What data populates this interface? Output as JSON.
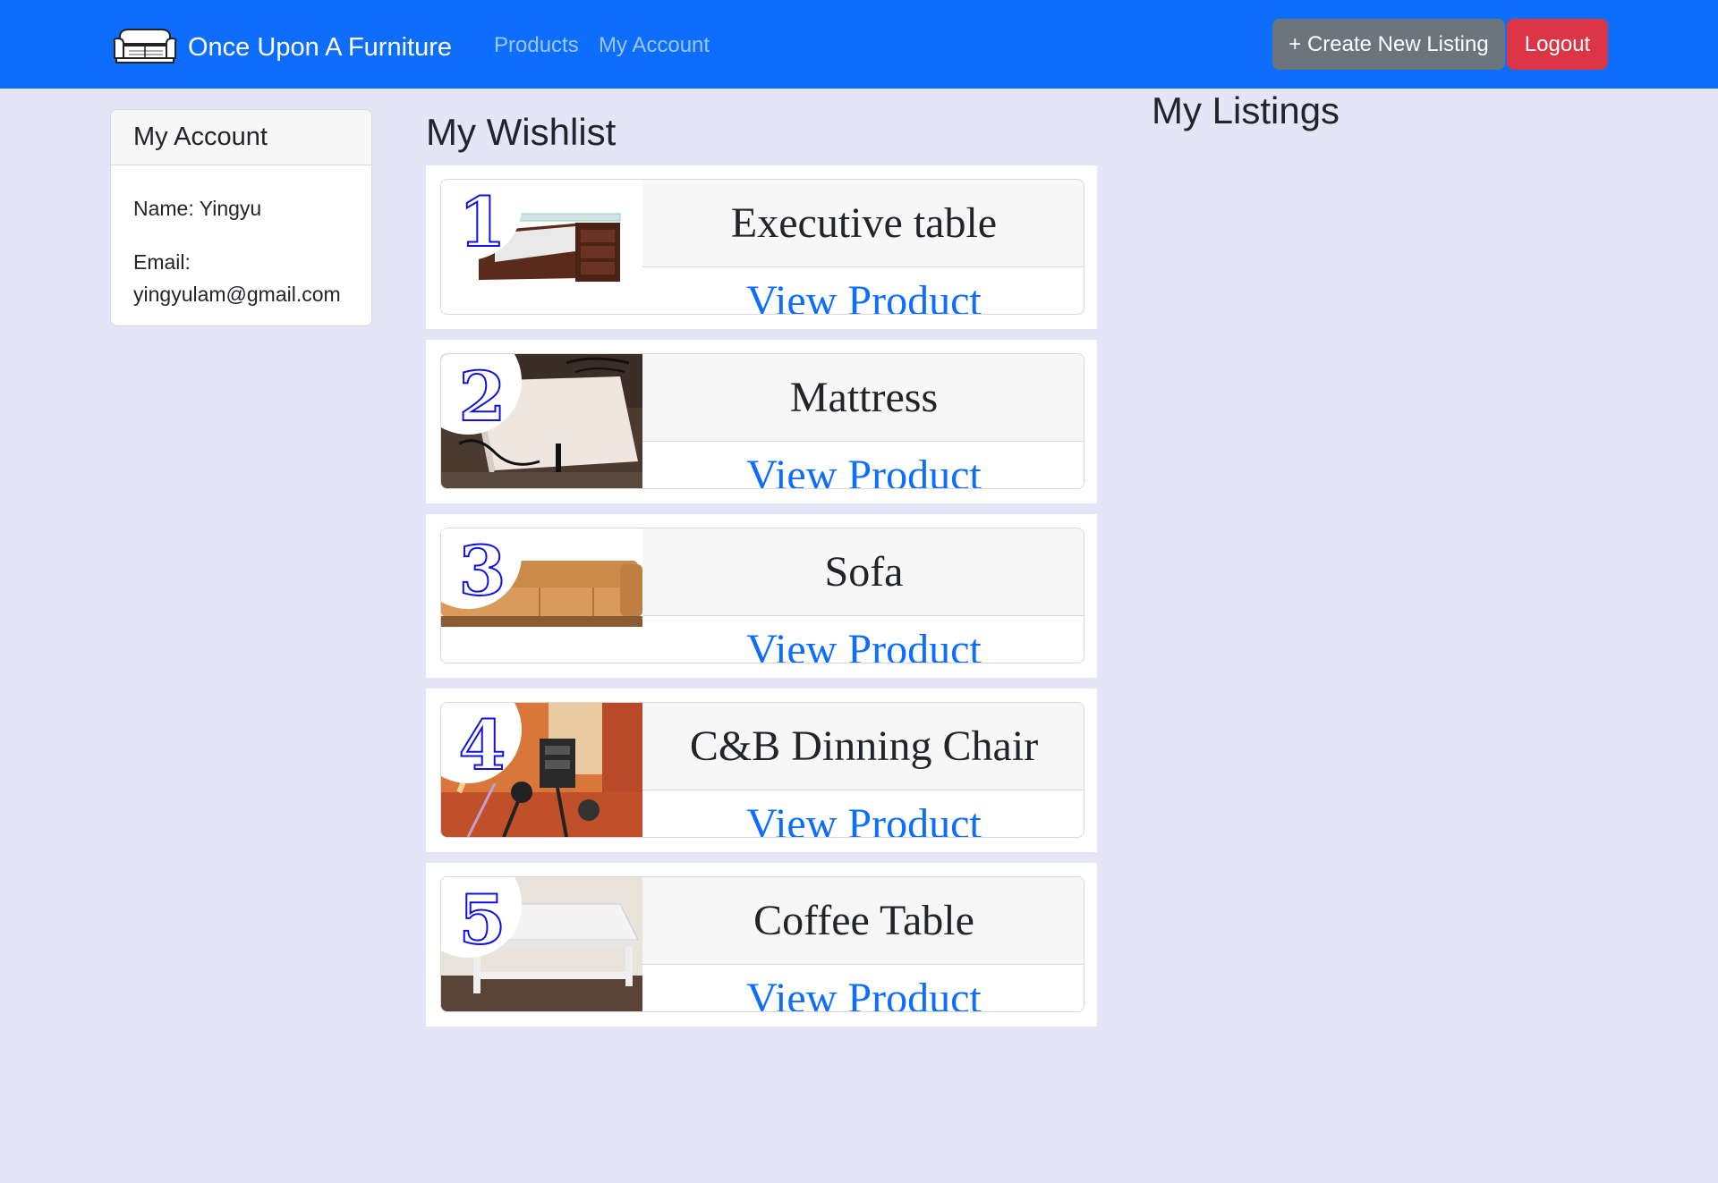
{
  "navbar": {
    "brand": "Once Upon A Furniture",
    "brand_icon": "sofa-icon",
    "links": [
      "Products",
      "My Account"
    ],
    "create_label": "+ Create New Listing",
    "logout_label": "Logout",
    "colors": {
      "primary": "#0d6efd",
      "secondary": "#6c757d",
      "danger": "#dc3545"
    }
  },
  "account": {
    "title": "My Account",
    "name_line": "Name: Yingyu",
    "email_label": "Email:",
    "email": "yingyulam@gmail.com"
  },
  "wishlist": {
    "title": "My Wishlist",
    "items": [
      {
        "rank": "1",
        "name": "Executive table",
        "link": "View Product"
      },
      {
        "rank": "2",
        "name": "Mattress",
        "link": "View Product"
      },
      {
        "rank": "3",
        "name": "Sofa",
        "link": "View Product"
      },
      {
        "rank": "4",
        "name": "C&B Dinning Chair",
        "link": "View Product"
      },
      {
        "rank": "5",
        "name": "Coffee Table",
        "link": "View Product"
      }
    ]
  },
  "listings": {
    "title": "My Listings"
  },
  "page_background": "#e5e5f8"
}
